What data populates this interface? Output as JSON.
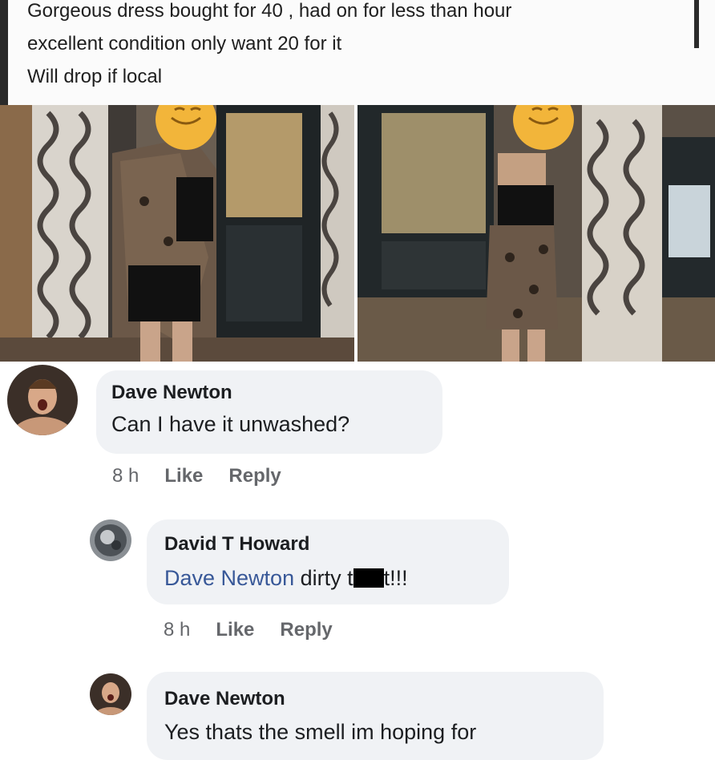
{
  "post": {
    "lines": [
      "Gorgeous dress bought for 40 , had on for less than hour",
      "excellent condition only want 20 for it",
      "Will drop if local"
    ]
  },
  "photos": [
    {
      "icon": "emoji-face-icon"
    },
    {
      "icon": "emoji-face-icon"
    }
  ],
  "comments": [
    {
      "author": "Dave Newton",
      "text": "Can I have it unwashed?",
      "time": "8 h",
      "like": "Like",
      "reply": "Reply"
    },
    {
      "author": "David T Howard",
      "mention": "Dave Newton",
      "text_before": " dirty t",
      "text_after": "t!!!",
      "time": "8 h",
      "like": "Like",
      "reply": "Reply"
    },
    {
      "author": "Dave Newton",
      "text": "Yes thats the smell im hoping for"
    }
  ],
  "colors": {
    "bubble": "#f0f2f5",
    "mention": "#385898",
    "meta": "#65676b",
    "emoji": "#f2b53a"
  }
}
